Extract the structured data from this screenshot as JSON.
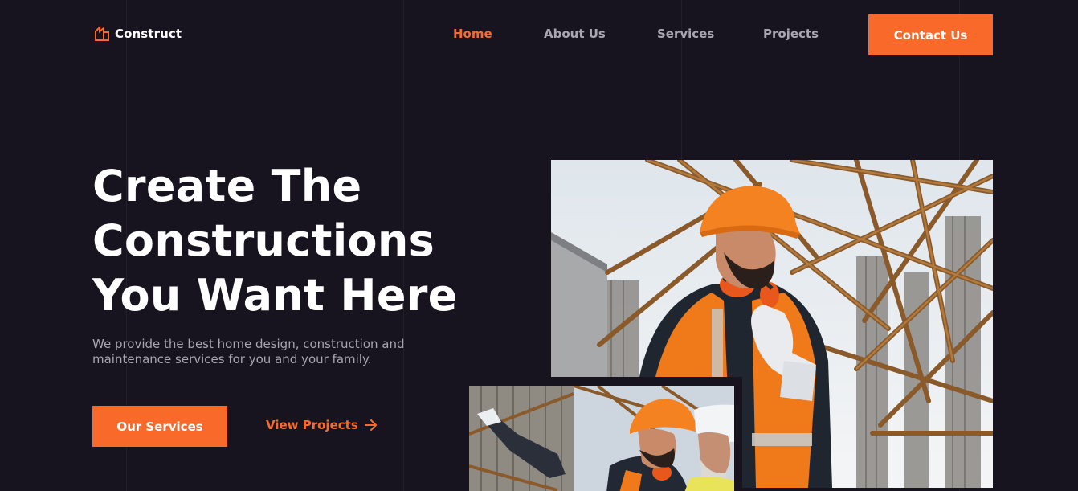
{
  "brand": {
    "name": "Construct",
    "logo_icon": "house-outline-icon",
    "accent_color": "#f96a2a",
    "background_color": "#17141f"
  },
  "nav": {
    "items": [
      {
        "label": "Home",
        "active": true
      },
      {
        "label": "About Us",
        "active": false
      },
      {
        "label": "Services",
        "active": false
      },
      {
        "label": "Projects",
        "active": false
      }
    ],
    "cta_label": "Contact Us"
  },
  "hero": {
    "title_lines": [
      "Create The",
      "Constructions",
      "You Want Here"
    ],
    "description": "We provide the best home design, construction and maintenance services for you and your family.",
    "primary_button": "Our Services",
    "secondary_link": "View Projects",
    "secondary_link_icon": "arrow-right-icon"
  },
  "images": {
    "main_alt": "construction-worker-photo",
    "secondary_alt": "workers-pointing-photo"
  }
}
